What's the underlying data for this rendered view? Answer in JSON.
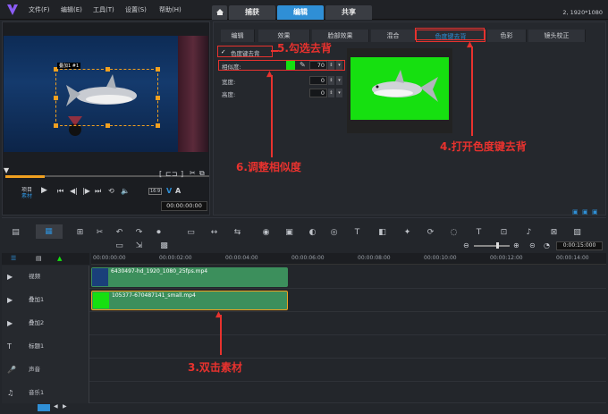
{
  "app": {
    "menu": [
      "文件(F)",
      "编辑(E)",
      "工具(T)",
      "设置(S)",
      "帮助(H)"
    ],
    "tabs": [
      "捕获",
      "编辑",
      "共享"
    ],
    "active_tab": "编辑",
    "resolution": "2, 1920*1080"
  },
  "preview": {
    "video_label": "叠加1 #1",
    "project_label": "项目",
    "clip_label": "素材",
    "timecode": "00:00:00:00",
    "zoom_label": "16:9"
  },
  "options": {
    "tabs": [
      "编辑",
      "效果",
      "脸部效果",
      "混合",
      "色度键去背",
      "色彩",
      "镜头校正"
    ],
    "active_tab": "色度键去背",
    "chroma_checkbox_label": "色度键去背",
    "chroma_checked": true,
    "similarity_label": "相似度:",
    "similarity_value": "70",
    "width_label": "宽度:",
    "width_value": "0",
    "height_label": "高度:",
    "height_value": "0",
    "key_color": "#16e010"
  },
  "annotations": {
    "step3": "3.双击素材",
    "step4": "4.打开色度键去背",
    "step5": "5.勾选去背",
    "step6": "6.调整相似度"
  },
  "timeline": {
    "toolbar_time": "0:00:15:000",
    "ruler": [
      "00:00:00:00",
      "00:00:02:00",
      "00:00:04:00",
      "00:00:06:00",
      "00:00:08:00",
      "00:00:10:00",
      "00:00:12:00",
      "00:00:14:00"
    ],
    "tracks": [
      {
        "name": "视频"
      },
      {
        "name": "叠加1"
      },
      {
        "name": "叠加2"
      },
      {
        "name": "标题1"
      },
      {
        "name": "声音"
      },
      {
        "name": "音乐1"
      }
    ],
    "clips": [
      {
        "name": "6430497-hd_1920_1080_25fps.mp4"
      },
      {
        "name": "105377-670487141_small.mp4"
      }
    ]
  }
}
